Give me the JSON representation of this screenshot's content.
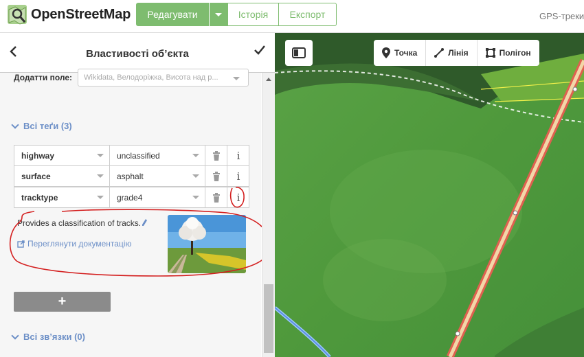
{
  "topbar": {
    "site_name": "OpenStreetMap",
    "edit_label": "Редагувати",
    "history_label": "Історія",
    "export_label": "Експорт",
    "gps_label": "GPS-треки"
  },
  "sidebar": {
    "title": "Властивості об’єкта",
    "add_field": {
      "label": "Додатти поле:",
      "placeholder": "Wikidata, Велодоріжка, Висота над р..."
    },
    "all_tags_label": "Всі теґи (3)",
    "tags": [
      {
        "key": "highway",
        "value": "unclassified"
      },
      {
        "key": "surface",
        "value": "asphalt"
      },
      {
        "key": "tracktype",
        "value": "grade4"
      }
    ],
    "doc": {
      "description": "Provides a classification of tracks.",
      "link_label": "Переглянути документацію"
    },
    "add_tag_label": "+",
    "relations_label": "Всі зв’язки (0)"
  },
  "map": {
    "draw_buttons": [
      {
        "label": "Точка",
        "icon": "marker-icon"
      },
      {
        "label": "Лінія",
        "icon": "line-icon"
      },
      {
        "label": "Полігон",
        "icon": "polygon-icon"
      }
    ]
  },
  "colors": {
    "accent_green": "#7ebc6f",
    "link_blue": "#6c8fc7",
    "road_red": "#e06050",
    "annotation_red": "#d42020"
  }
}
